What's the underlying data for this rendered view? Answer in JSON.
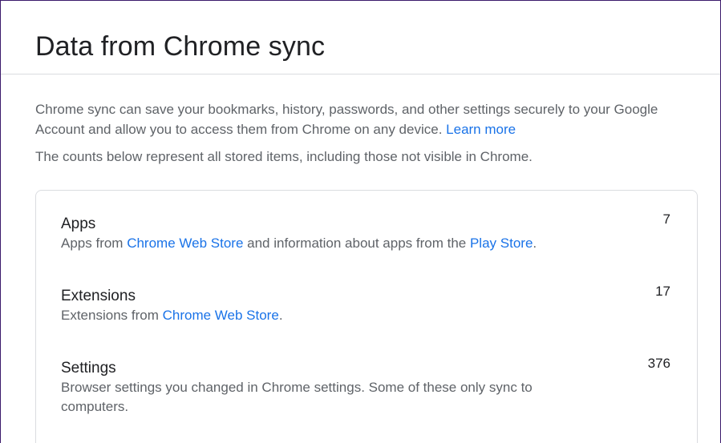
{
  "page": {
    "title": "Data from Chrome sync"
  },
  "intro": {
    "text": "Chrome sync can save your bookmarks, history, passwords, and other settings securely to your Google Account and allow you to access them from Chrome on any device. ",
    "learn_more": "Learn more"
  },
  "counts_note": "The counts below represent all stored items, including those not visible in Chrome.",
  "items": [
    {
      "name": "Apps",
      "count": "7",
      "desc_before": "Apps from ",
      "link1": "Chrome Web Store",
      "desc_middle": " and information about apps from the ",
      "link2": "Play Store",
      "desc_after": "."
    },
    {
      "name": "Extensions",
      "count": "17",
      "desc_before": "Extensions from ",
      "link1": "Chrome Web Store",
      "desc_after": "."
    },
    {
      "name": "Settings",
      "count": "376",
      "desc": "Browser settings you changed in Chrome settings. Some of these only sync to computers."
    }
  ]
}
